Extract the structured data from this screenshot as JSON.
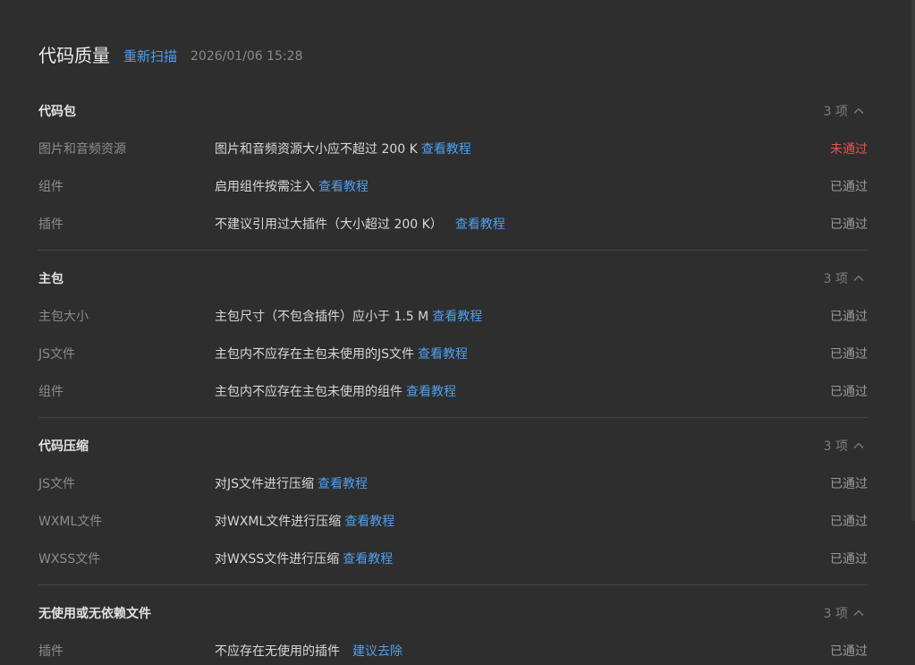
{
  "header": {
    "title": "代码质量",
    "rescan_label": "重新扫描",
    "timestamp": "2026/01/06 15:28"
  },
  "sections": [
    {
      "title": "代码包",
      "count": "3 项",
      "rows": [
        {
          "name": "图片和音频资源",
          "desc": "图片和音频资源大小应不超过 200 K",
          "link": "查看教程",
          "status": "未通过"
        },
        {
          "name": "组件",
          "desc": "启用组件按需注入",
          "link": "查看教程",
          "status": "已通过"
        },
        {
          "name": "插件",
          "desc": "不建议引用过大插件（大小超过 200 K）",
          "link": "查看教程",
          "status": "已通过"
        }
      ]
    },
    {
      "title": "主包",
      "count": "3 项",
      "rows": [
        {
          "name": "主包大小",
          "desc": "主包尺寸（不包含插件）应小于 1.5 M",
          "link": "查看教程",
          "status": "已通过"
        },
        {
          "name": "JS文件",
          "desc": "主包内不应存在主包未使用的JS文件",
          "link": "查看教程",
          "status": "已通过"
        },
        {
          "name": "组件",
          "desc": "主包内不应存在主包未使用的组件",
          "link": "查看教程",
          "status": "已通过"
        }
      ]
    },
    {
      "title": "代码压缩",
      "count": "3 项",
      "rows": [
        {
          "name": "JS文件",
          "desc": "对JS文件进行压缩",
          "link": "查看教程",
          "status": "已通过"
        },
        {
          "name": "WXML文件",
          "desc": "对WXML文件进行压缩",
          "link": "查看教程",
          "status": "已通过"
        },
        {
          "name": "WXSS文件",
          "desc": "对WXSS文件进行压缩",
          "link": "查看教程",
          "status": "已通过"
        }
      ]
    },
    {
      "title": "无使用或无依赖文件",
      "count": "3 项",
      "rows": [
        {
          "name": "插件",
          "desc": "不应存在无使用的插件",
          "link": "建议去除",
          "status": "已通过"
        }
      ]
    }
  ],
  "colors": {
    "background": "#2e2e2e",
    "link": "#4f9fee",
    "fail": "#e4534e",
    "pass": "#9a9a9a"
  },
  "icons": {
    "collapse": "chevron-up-icon"
  }
}
